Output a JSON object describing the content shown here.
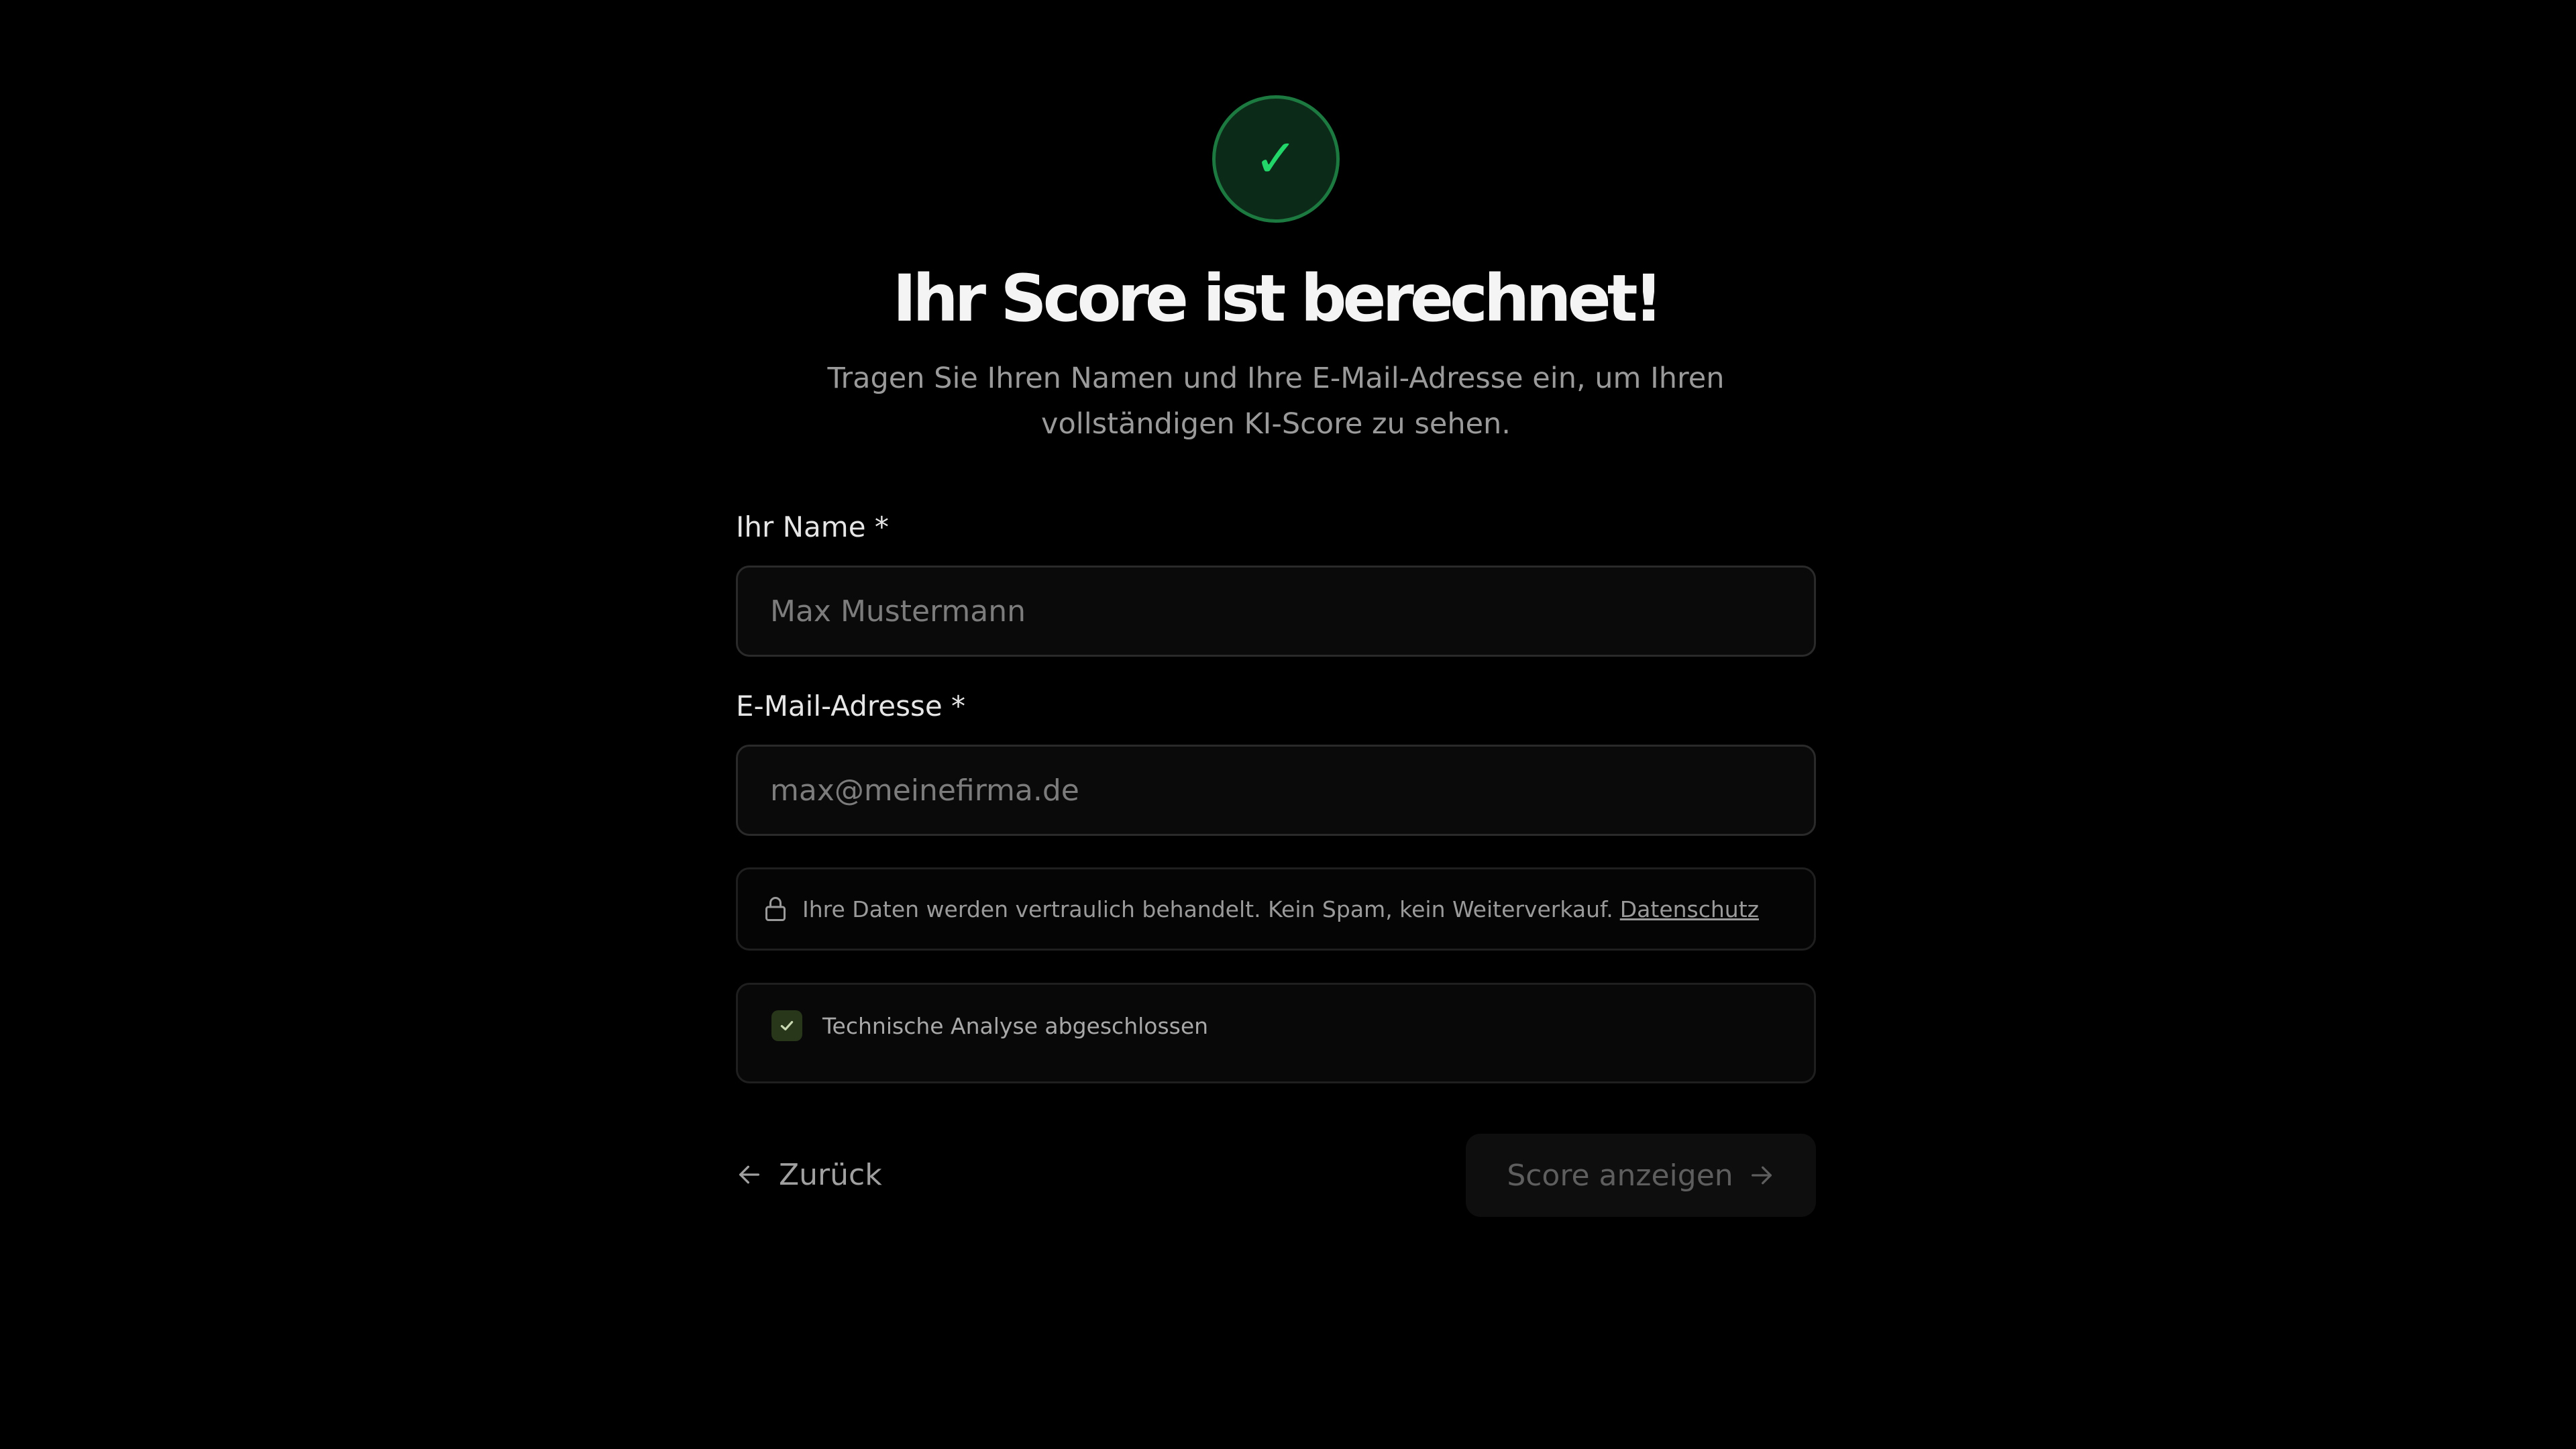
{
  "header": {
    "badge_icon": "check-icon",
    "badge_glyph": "✓",
    "title": "Ihr Score ist berechnet!",
    "subtitle": "Tragen Sie Ihren Namen und Ihre E-Mail-Adresse ein, um Ihren vollständigen KI-Score zu sehen."
  },
  "form": {
    "name_label": "Ihr Name *",
    "name_placeholder": "Max Mustermann",
    "name_value": "",
    "email_label": "E-Mail-Adresse *",
    "email_placeholder": "max@meinefirma.de",
    "email_value": ""
  },
  "privacy": {
    "icon": "lock-icon",
    "text": "Ihre Daten werden vertraulich behandelt. Kein Spam, kein Weiterverkauf.",
    "link_label": "Datenschutz"
  },
  "status": {
    "icon": "check-icon",
    "checked": true,
    "label": "Technische Analyse abgeschlossen"
  },
  "actions": {
    "back_label": "Zurück",
    "back_icon": "arrow-left-icon",
    "submit_label": "Score anzeigen",
    "submit_icon": "arrow-right-icon",
    "submit_disabled": true
  },
  "colors": {
    "background": "#000000",
    "accent_green": "#22d66a",
    "badge_bg": "#0b2a18",
    "badge_border": "#1c7a41",
    "checkbox_bg": "#28361a"
  }
}
